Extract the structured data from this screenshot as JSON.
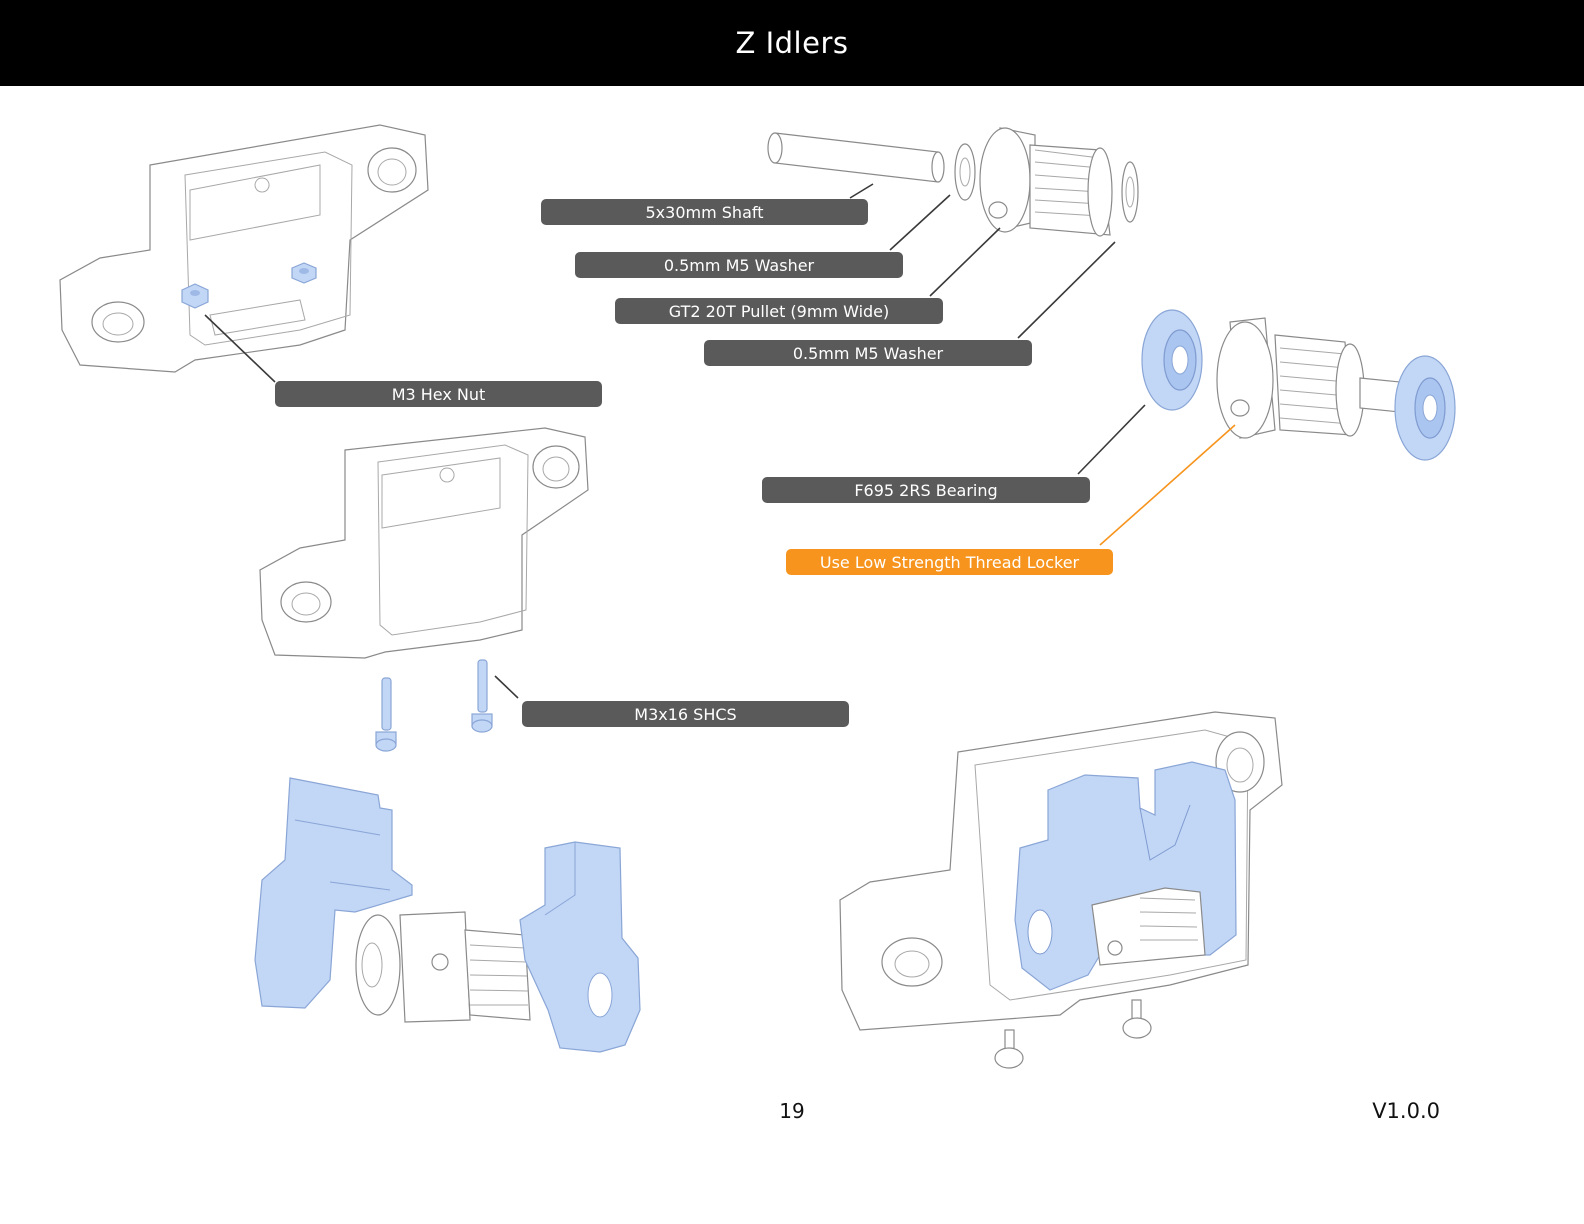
{
  "header": {
    "title": "Z Idlers"
  },
  "callouts": {
    "shaft": "5x30mm Shaft",
    "washer_top": "0.5mm M5 Washer",
    "pulley": "GT2 20T Pullet (9mm Wide)",
    "washer_bottom": "0.5mm M5 Washer",
    "hex_nut": "M3 Hex Nut",
    "bearing": "F695 2RS Bearing",
    "thread_locker": "Use Low Strength Thread Locker",
    "screws": "M3x16 SHCS"
  },
  "footer": {
    "page_number": "19",
    "version": "V1.0.0"
  },
  "colors": {
    "header_bg": "#000000",
    "label_bg": "#5a5a5a",
    "highlight_label": "#f7941d",
    "part_highlight": "#c2d6f6"
  }
}
